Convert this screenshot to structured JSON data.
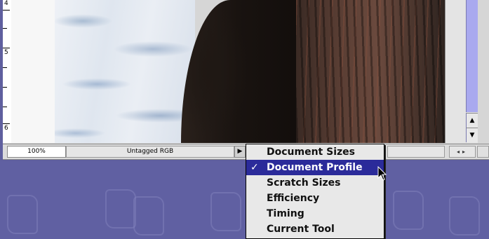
{
  "status_bar": {
    "zoom": "100%",
    "profile": "Untagged RGB",
    "popup_arrow_icon": "triangle-right-icon"
  },
  "ruler": {
    "labels": [
      "4",
      "5",
      "6"
    ]
  },
  "popup_menu": {
    "items": [
      {
        "label": "Document Sizes",
        "checked": false,
        "selected": false
      },
      {
        "label": "Document Profile",
        "checked": true,
        "selected": true
      },
      {
        "label": "Scratch Sizes",
        "checked": false,
        "selected": false
      },
      {
        "label": "Efficiency",
        "checked": false,
        "selected": false
      },
      {
        "label": "Timing",
        "checked": false,
        "selected": false
      },
      {
        "label": "Current Tool",
        "checked": false,
        "selected": false
      }
    ],
    "check_glyph": "✓"
  },
  "colors": {
    "desktop": "#6060a2",
    "menu_highlight": "#2b2b9a",
    "scroll_track": "#a9a9ef"
  }
}
